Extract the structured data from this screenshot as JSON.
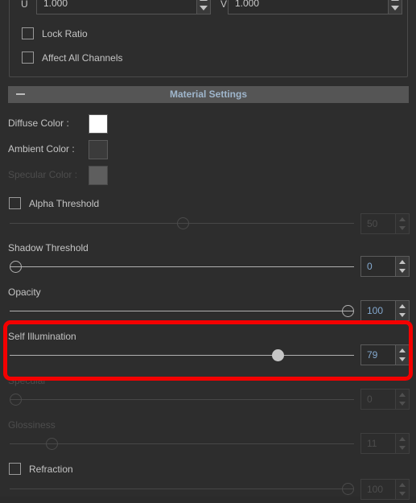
{
  "uv_row": {
    "u_label": "U",
    "u_value": "1.000",
    "v_label": "V",
    "v_value": "1.000"
  },
  "checkboxes_top": [
    {
      "label": "Lock Ratio",
      "checked": false,
      "enabled": true
    },
    {
      "label": "Affect All Channels",
      "checked": false,
      "enabled": true
    }
  ],
  "section": {
    "title": "Material Settings",
    "collapse_icon": "minus-icon",
    "expanded": true
  },
  "color_rows": [
    {
      "label": "Diffuse Color :",
      "color": "#ffffff",
      "enabled": true
    },
    {
      "label": "Ambient Color :",
      "color": "#3b3b3b",
      "enabled": true
    },
    {
      "label": "Specular Color :",
      "color": "#5e5e5e",
      "enabled": false
    }
  ],
  "alpha_threshold": {
    "label": "Alpha Threshold",
    "checked": false,
    "enabled": false,
    "value": "50",
    "percent": 50
  },
  "sliders": [
    {
      "label": "Shadow Threshold",
      "value": "0",
      "percent": 0,
      "enabled": true,
      "handle_filled": false,
      "highlighted": false
    },
    {
      "label": "Opacity",
      "value": "100",
      "percent": 100,
      "enabled": true,
      "handle_filled": false,
      "highlighted": false
    },
    {
      "label": "Self Illumination",
      "value": "79",
      "percent": 79,
      "enabled": true,
      "handle_filled": true,
      "highlighted": true
    },
    {
      "label": "Specular",
      "value": "0",
      "percent": 0,
      "enabled": false,
      "handle_filled": false,
      "highlighted": false
    },
    {
      "label": "Glossiness",
      "value": "11",
      "percent": 11,
      "enabled": false,
      "handle_filled": false,
      "highlighted": false
    }
  ],
  "refraction": {
    "label": "Refraction",
    "checked": false,
    "enabled": true,
    "value": "100",
    "percent": 100
  },
  "colors": {
    "background": "#2d2d2d",
    "header_bar": "#555555",
    "header_text": "#9fb6cc",
    "label_text": "#c4c4c4",
    "disabled_text": "#4d4d4d",
    "value_text": "#84a9cf",
    "annotation": "#f40000"
  }
}
